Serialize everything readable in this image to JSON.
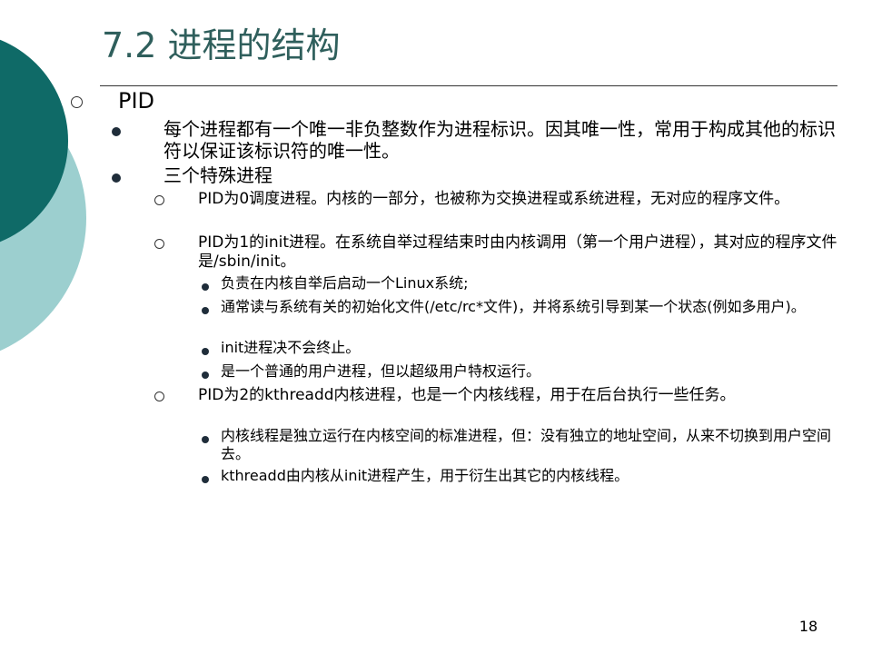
{
  "slide": {
    "title": "7.2 进程的结构",
    "page_number": "18"
  },
  "colors": {
    "title": "#2f5f5c",
    "accent_dark": "#0f6a67",
    "accent_light": "#9ccfcf"
  },
  "content": {
    "pid_heading": "PID",
    "pid_identifier": "每个进程都有一个唯一非负整数作为进程标识。因其唯一性，常用于构成其他的标识符以保证该标识符的唯一性。",
    "special_processes": "三个特殊进程",
    "pid0": "PID为0调度进程。内核的一部分，也被称为交换进程或系统进程，无对应的程序文件。",
    "pid1": "PID为1的init进程。在系统自举过程结束时由内核调用（第一个用户进程），其对应的程序文件是/sbin/init。",
    "pid1_details": [
      "负责在内核自举后启动一个Linux系统;",
      "通常读与系统有关的初始化文件(/etc/rc*文件)，并将系统引导到某一个状态(例如多用户)。",
      "init进程决不会终止。",
      "是一个普通的用户进程，但以超级用户特权运行。"
    ],
    "pid2": "PID为2的kthreadd内核进程，也是一个内核线程，用于在后台执行一些任务。",
    "pid2_details": [
      "内核线程是独立运行在内核空间的标准进程，但：没有独立的地址空间，从来不切换到用户空间去。",
      "kthreadd由内核从init进程产生，用于衍生出其它的内核线程。"
    ]
  }
}
